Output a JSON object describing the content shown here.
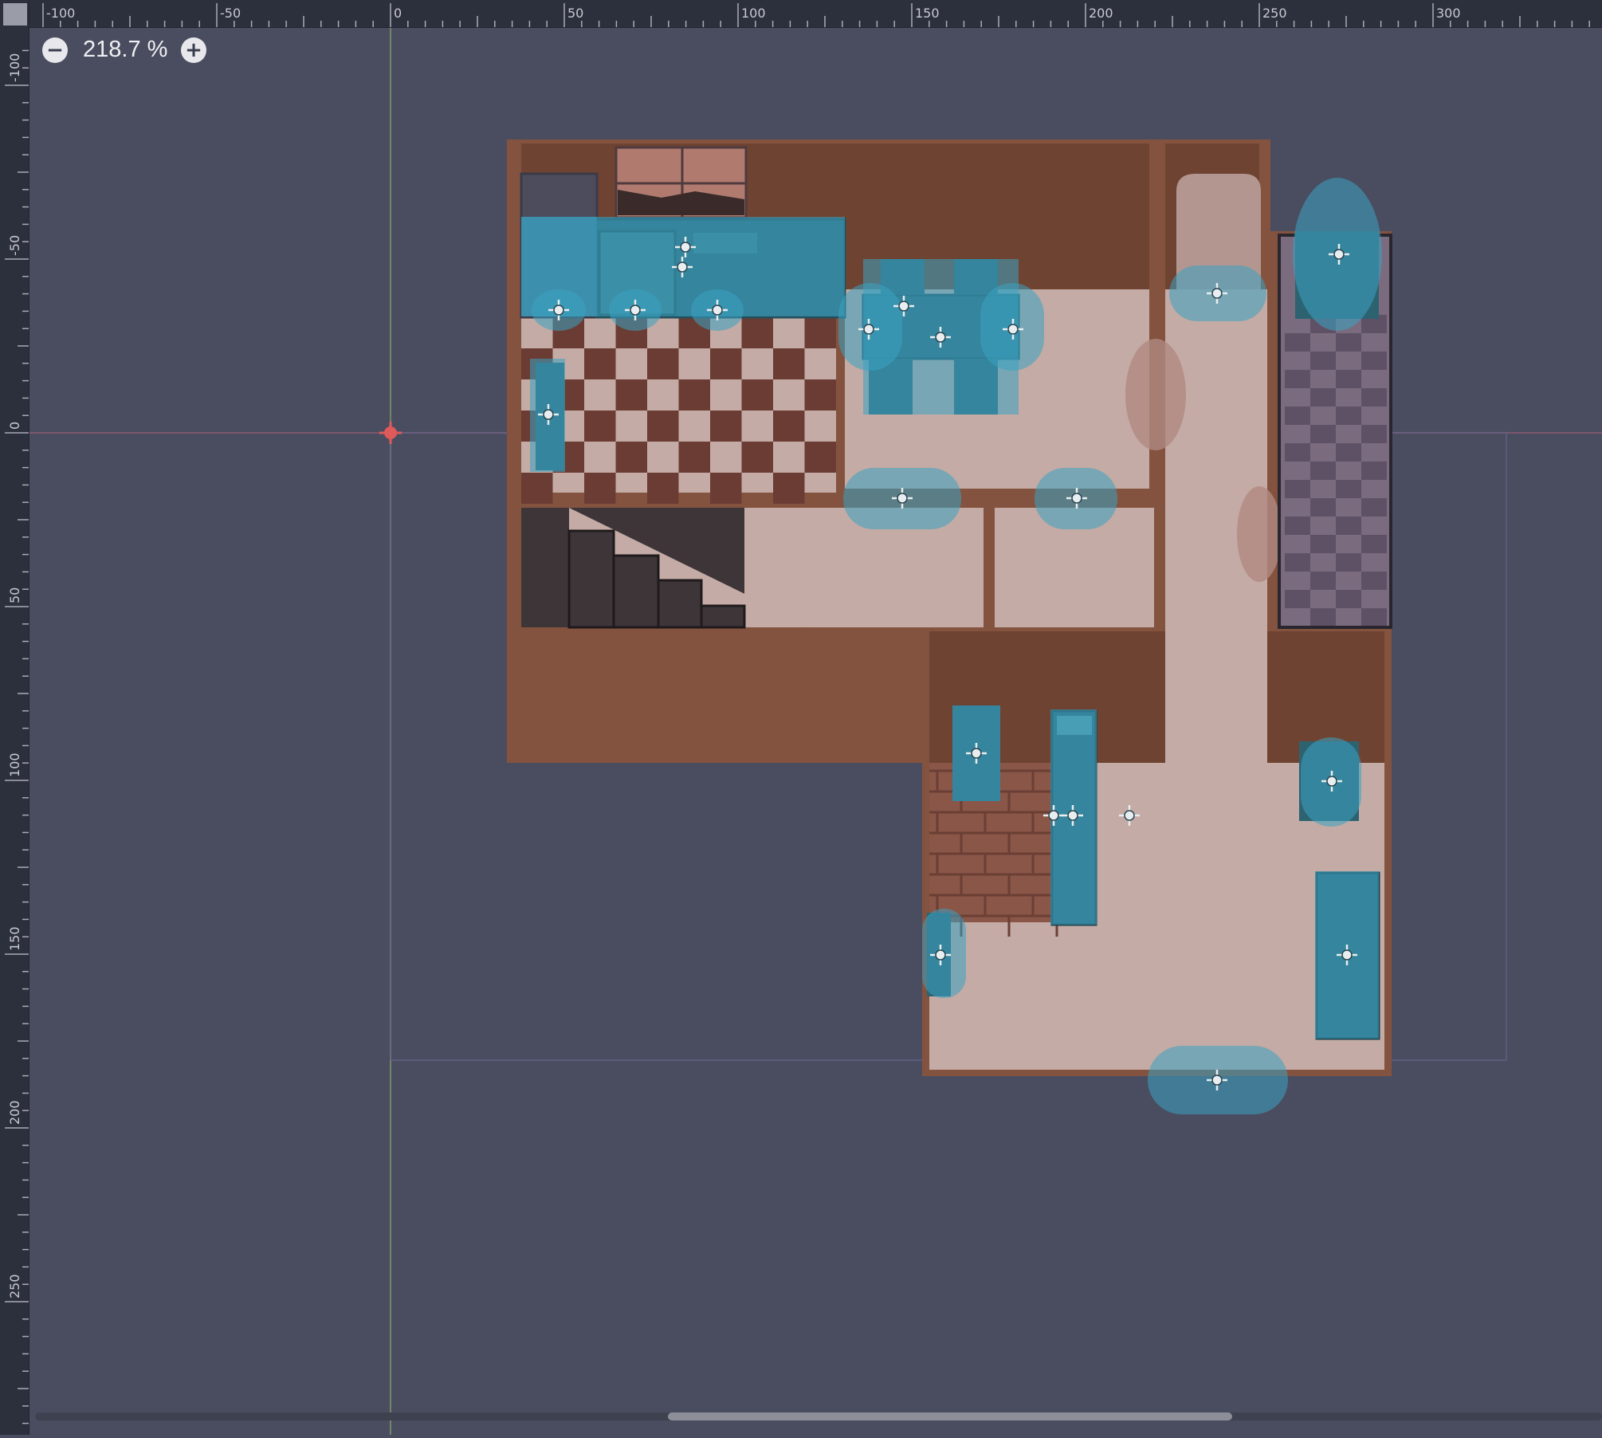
{
  "editor": {
    "zoom_label": "218.7 %",
    "zoom_out_icon": "minus-circle-icon",
    "zoom_in_icon": "plus-circle-icon"
  },
  "rulers": {
    "horizontal_labels": [
      "-100",
      "-50",
      "0",
      "50",
      "100",
      "150",
      "200",
      "250",
      "300"
    ],
    "vertical_labels": [
      "-100",
      "-50",
      "0",
      "50",
      "100",
      "150",
      "200",
      "250"
    ]
  },
  "colors": {
    "canvas_bg": "#4a4d60",
    "ruler_bg": "#2c2f3c",
    "wall": "#84533f",
    "wall_dark": "#6f4331",
    "floor": "#c4aba5",
    "checker_dark": "#6b3c34",
    "bathroom_tile": "#5e5166",
    "collision_fill": "#3aa3c1",
    "origin_marker": "#e05a5a",
    "axis_x": "#b05f79",
    "axis_y": "#9bc36a"
  },
  "scene": {
    "nodes": [
      {
        "name": "counter-collision"
      },
      {
        "name": "stove-collision"
      },
      {
        "name": "dining-table-collision"
      },
      {
        "name": "door-collision"
      },
      {
        "name": "bath-plant-collision"
      },
      {
        "name": "lamp-collision"
      },
      {
        "name": "bed-collision"
      },
      {
        "name": "chair-collision"
      },
      {
        "name": "dresser-collision"
      },
      {
        "name": "exit-door-collision"
      }
    ]
  }
}
